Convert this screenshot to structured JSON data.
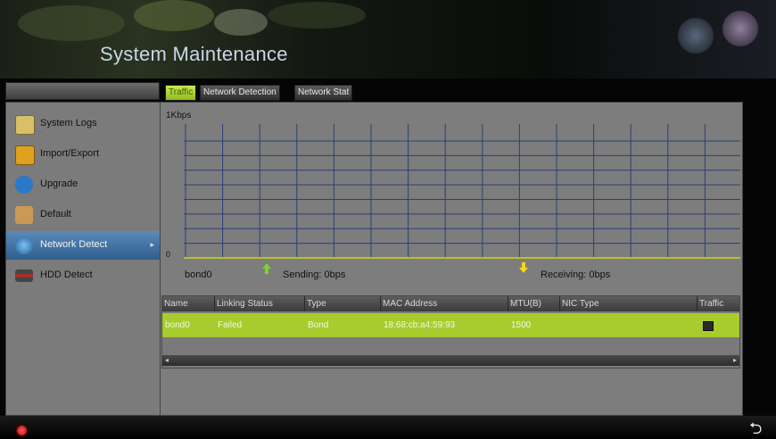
{
  "header": {
    "title": "System Maintenance"
  },
  "sidebar": {
    "items": [
      {
        "label": "System Logs",
        "icon": "logs-icon",
        "color": "#d8c06a"
      },
      {
        "label": "Import/Export",
        "icon": "import-export-icon",
        "color": "#e0a020"
      },
      {
        "label": "Upgrade",
        "icon": "upgrade-icon",
        "color": "#2b78c8"
      },
      {
        "label": "Default",
        "icon": "default-box-icon",
        "color": "#c89a55"
      },
      {
        "label": "Network Detect",
        "icon": "network-globe-icon",
        "color": "#3a8fd8",
        "active": true
      },
      {
        "label": "HDD Detect",
        "icon": "hdd-icon",
        "color": "#a03030"
      }
    ],
    "active_arrow": "▸"
  },
  "tabs": [
    {
      "label": "Traffic",
      "active": true
    },
    {
      "label": "Network Detection"
    },
    {
      "label": "Network Stat"
    }
  ],
  "graph": {
    "y_top_label": "1Kbps",
    "y_zero_label": "0",
    "grid_color": "#2c3f7a",
    "baseline_color": "#b9c12c",
    "interface": "bond0",
    "sending": "Sending: 0bps",
    "receiving": "Receiving: 0bps",
    "sending_color": "#7fd12a",
    "receiving_color": "#ffd31a"
  },
  "table": {
    "columns": [
      "Name",
      "Linking Status",
      "Type",
      "MAC Address",
      "MTU(B)",
      "NIC Type",
      "Traffic"
    ],
    "rows": [
      {
        "name": "bond0",
        "status": "Failed",
        "type": "Bond",
        "mac": "18:68:cb:a4:59:93",
        "mtu": "1500",
        "nic": ""
      }
    ],
    "selected_color": "#a7cc2e",
    "scroll_left": "◂",
    "scroll_right": "▸"
  },
  "bottom": {
    "back_symbol": "⮌"
  }
}
